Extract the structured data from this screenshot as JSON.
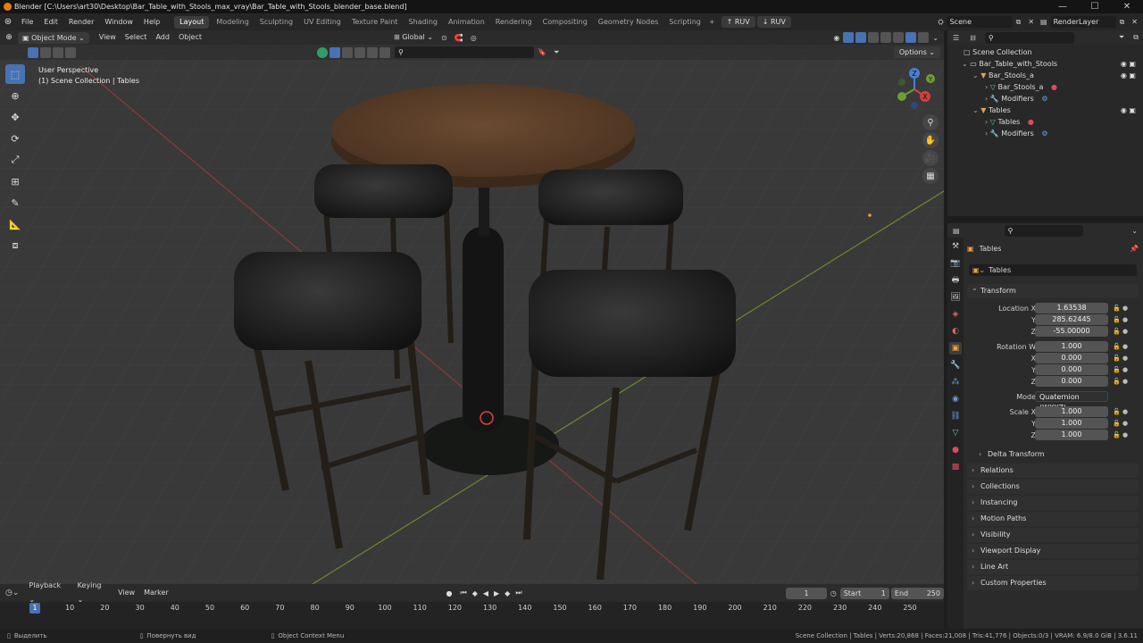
{
  "window": {
    "title": "Blender [C:\\Users\\art30\\Desktop\\Bar_Table_with_Stools_max_vray\\Bar_Table_with_Stools_blender_base.blend]",
    "controls": [
      "—",
      "☐",
      "✕"
    ]
  },
  "menu": {
    "items": [
      "File",
      "Edit",
      "Render",
      "Window",
      "Help"
    ],
    "workspaces": [
      "Layout",
      "Modeling",
      "Sculpting",
      "UV Editing",
      "Texture Paint",
      "Shading",
      "Animation",
      "Rendering",
      "Compositing",
      "Geometry Nodes",
      "Scripting"
    ],
    "active_workspace": "Layout",
    "ruv_up": "RUV",
    "ruv_down": "RUV",
    "scene": "Scene",
    "view_layer": "RenderLayer"
  },
  "viewport": {
    "mode": "Object Mode",
    "menus": [
      "View",
      "Select",
      "Add",
      "Object"
    ],
    "orientation": "Global",
    "options_label": "Options",
    "info_line1": "User Perspective",
    "info_line2": "(1) Scene Collection | Tables",
    "gizmo_labels": {
      "z": "Z",
      "y": "Y",
      "x": "X"
    }
  },
  "outliner": {
    "rows": [
      {
        "label": "Scene Collection",
        "indent": 0
      },
      {
        "label": "Bar_Table_with_Stools",
        "indent": 1
      },
      {
        "label": "Bar_Stools_a",
        "indent": 2
      },
      {
        "label": "Bar_Stools_a",
        "indent": 3
      },
      {
        "label": "Modifiers",
        "indent": 3
      },
      {
        "label": "Tables",
        "indent": 2
      },
      {
        "label": "Tables",
        "indent": 3
      },
      {
        "label": "Modifiers",
        "indent": 3
      }
    ]
  },
  "properties": {
    "object_name": "Tables",
    "data_name": "Tables",
    "transform_label": "Transform",
    "location": {
      "label": "Location X",
      "x": "1.63538",
      "y": "285.62445",
      "z": "-55.00000"
    },
    "rotation": {
      "label": "Rotation W",
      "w": "1.000",
      "x": "0.000",
      "y": "0.000",
      "z": "0.000"
    },
    "mode": {
      "label": "Mode",
      "value": "Quaternion (WXYZ)"
    },
    "scale": {
      "label": "Scale X",
      "x": "1.000",
      "y": "1.000",
      "z": "1.000"
    },
    "axis_labels": {
      "x": "X",
      "y": "Y",
      "z": "Z"
    },
    "delta_transform": "Delta Transform",
    "panels": [
      "Relations",
      "Collections",
      "Instancing",
      "Motion Paths",
      "Visibility",
      "Viewport Display",
      "Line Art",
      "Custom Properties"
    ]
  },
  "timeline": {
    "menus": [
      "Playback",
      "Keying",
      "View",
      "Marker"
    ],
    "current_frame": "1",
    "start_label": "Start",
    "start": "1",
    "end_label": "End",
    "end": "250",
    "ticks": [
      "10",
      "20",
      "30",
      "40",
      "50",
      "60",
      "70",
      "80",
      "90",
      "100",
      "110",
      "120",
      "130",
      "140",
      "150",
      "160",
      "170",
      "180",
      "190",
      "200",
      "210",
      "220",
      "230",
      "240",
      "250"
    ]
  },
  "status": {
    "left": "Выделить",
    "middle": "Повернуть вид",
    "context": "Object Context Menu",
    "stats": "Scene Collection | Tables | Verts:20,868 | Faces:21,008 | Tris:41,776 | Objects:0/3 | VRAM: 6.9/8.0 GiB | 3.6.11"
  }
}
